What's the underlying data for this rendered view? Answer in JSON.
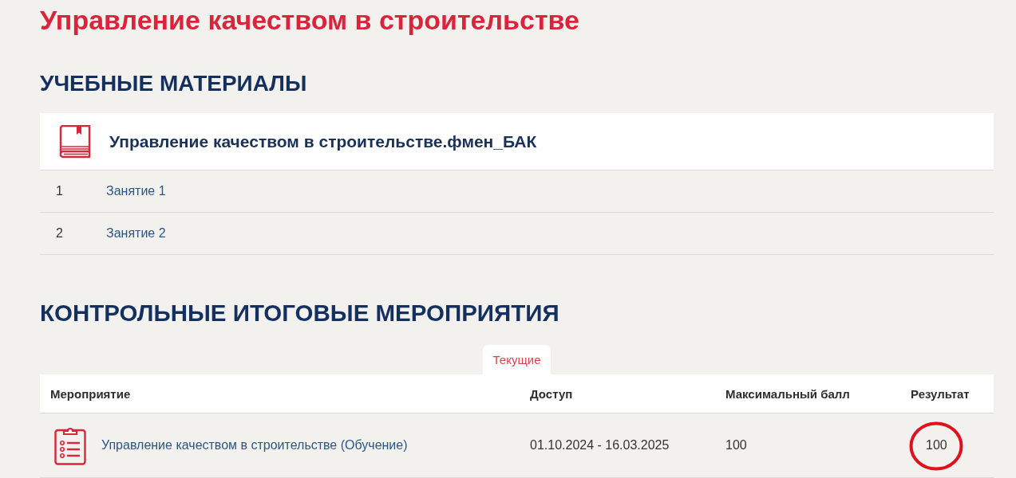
{
  "page": {
    "title": "Управление качеством в строительстве"
  },
  "materials": {
    "heading": "УЧЕБНЫЕ МАТЕРИАЛЫ",
    "course": {
      "title": "Управление качеством в строительстве.фмен_БАК"
    },
    "lessons": [
      {
        "number": "1",
        "title": "Занятие 1"
      },
      {
        "number": "2",
        "title": "Занятие 2"
      }
    ]
  },
  "assessments": {
    "heading": "КОНТРОЛЬНЫЕ ИТОГОВЫЕ МЕРОПРИЯТИЯ",
    "tabs": [
      {
        "label": "Текущие",
        "selected": true
      }
    ],
    "table": {
      "columns": [
        "Мероприятие",
        "Доступ",
        "Максимальный балл",
        "Результат"
      ],
      "rows": [
        {
          "event": "Управление качеством в строительстве (Обучение)",
          "access": "01.10.2024 - 16.03.2025",
          "max_score": "100",
          "result": "100",
          "result_circled": true
        }
      ]
    }
  }
}
